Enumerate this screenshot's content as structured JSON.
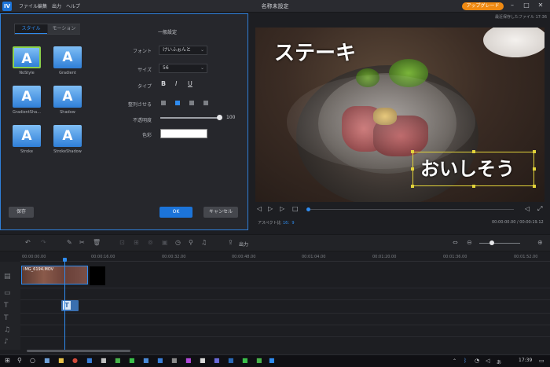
{
  "app": {
    "logo_text": "IV",
    "window_title": "名称未設定",
    "menu": [
      "ファイル",
      "編集",
      "出力",
      "ヘルプ"
    ],
    "upgrade_label": "アップグレード",
    "autosave": "最近保存したファイル 17:36",
    "accent_color": "#2f8cf0"
  },
  "panel": {
    "tabs": [
      "スタイル",
      "モーション"
    ],
    "section_title": "一般設定",
    "presets": [
      {
        "glyph": "A",
        "label": "NoStyle"
      },
      {
        "glyph": "A",
        "label": "Gradient"
      },
      {
        "glyph": "A",
        "label": "GradientSha..."
      },
      {
        "glyph": "A",
        "label": "Shadow"
      },
      {
        "glyph": "A",
        "label": "Stroke"
      },
      {
        "glyph": "A",
        "label": "StrokeShadow"
      }
    ],
    "font_label": "フォント",
    "font_value": "けいふぉんと",
    "size_label": "サイズ",
    "size_value": "56",
    "type_label": "タイプ",
    "bold": "B",
    "italic": "I",
    "underline": "U",
    "align_label": "整列させる",
    "opacity_label": "不透明度",
    "opacity_value": "100",
    "color_label": "色彩",
    "color_value": "#ffffff",
    "save_label": "保存",
    "ok_label": "OK",
    "cancel_label": "キャンセル"
  },
  "preview": {
    "caption_top": "ステーキ",
    "caption_bottom": "おいしそう"
  },
  "player": {
    "aspect_label": "アスペクト比",
    "aspect_value": "16：9",
    "timecode": "00:00:00.00 / 00:00:19.12"
  },
  "toolbar": {
    "export_label": "出力"
  },
  "timeline": {
    "ruler": [
      "00:00:00.00",
      "00:00:16.00",
      "00:00:32.00",
      "00:00:48.00",
      "00:01:04.00",
      "00:01:20.00",
      "00:01:36.00",
      "00:01:52.00"
    ],
    "clip_label": "IMG_6194.MOV"
  },
  "taskbar": {
    "clock": "17:39"
  }
}
